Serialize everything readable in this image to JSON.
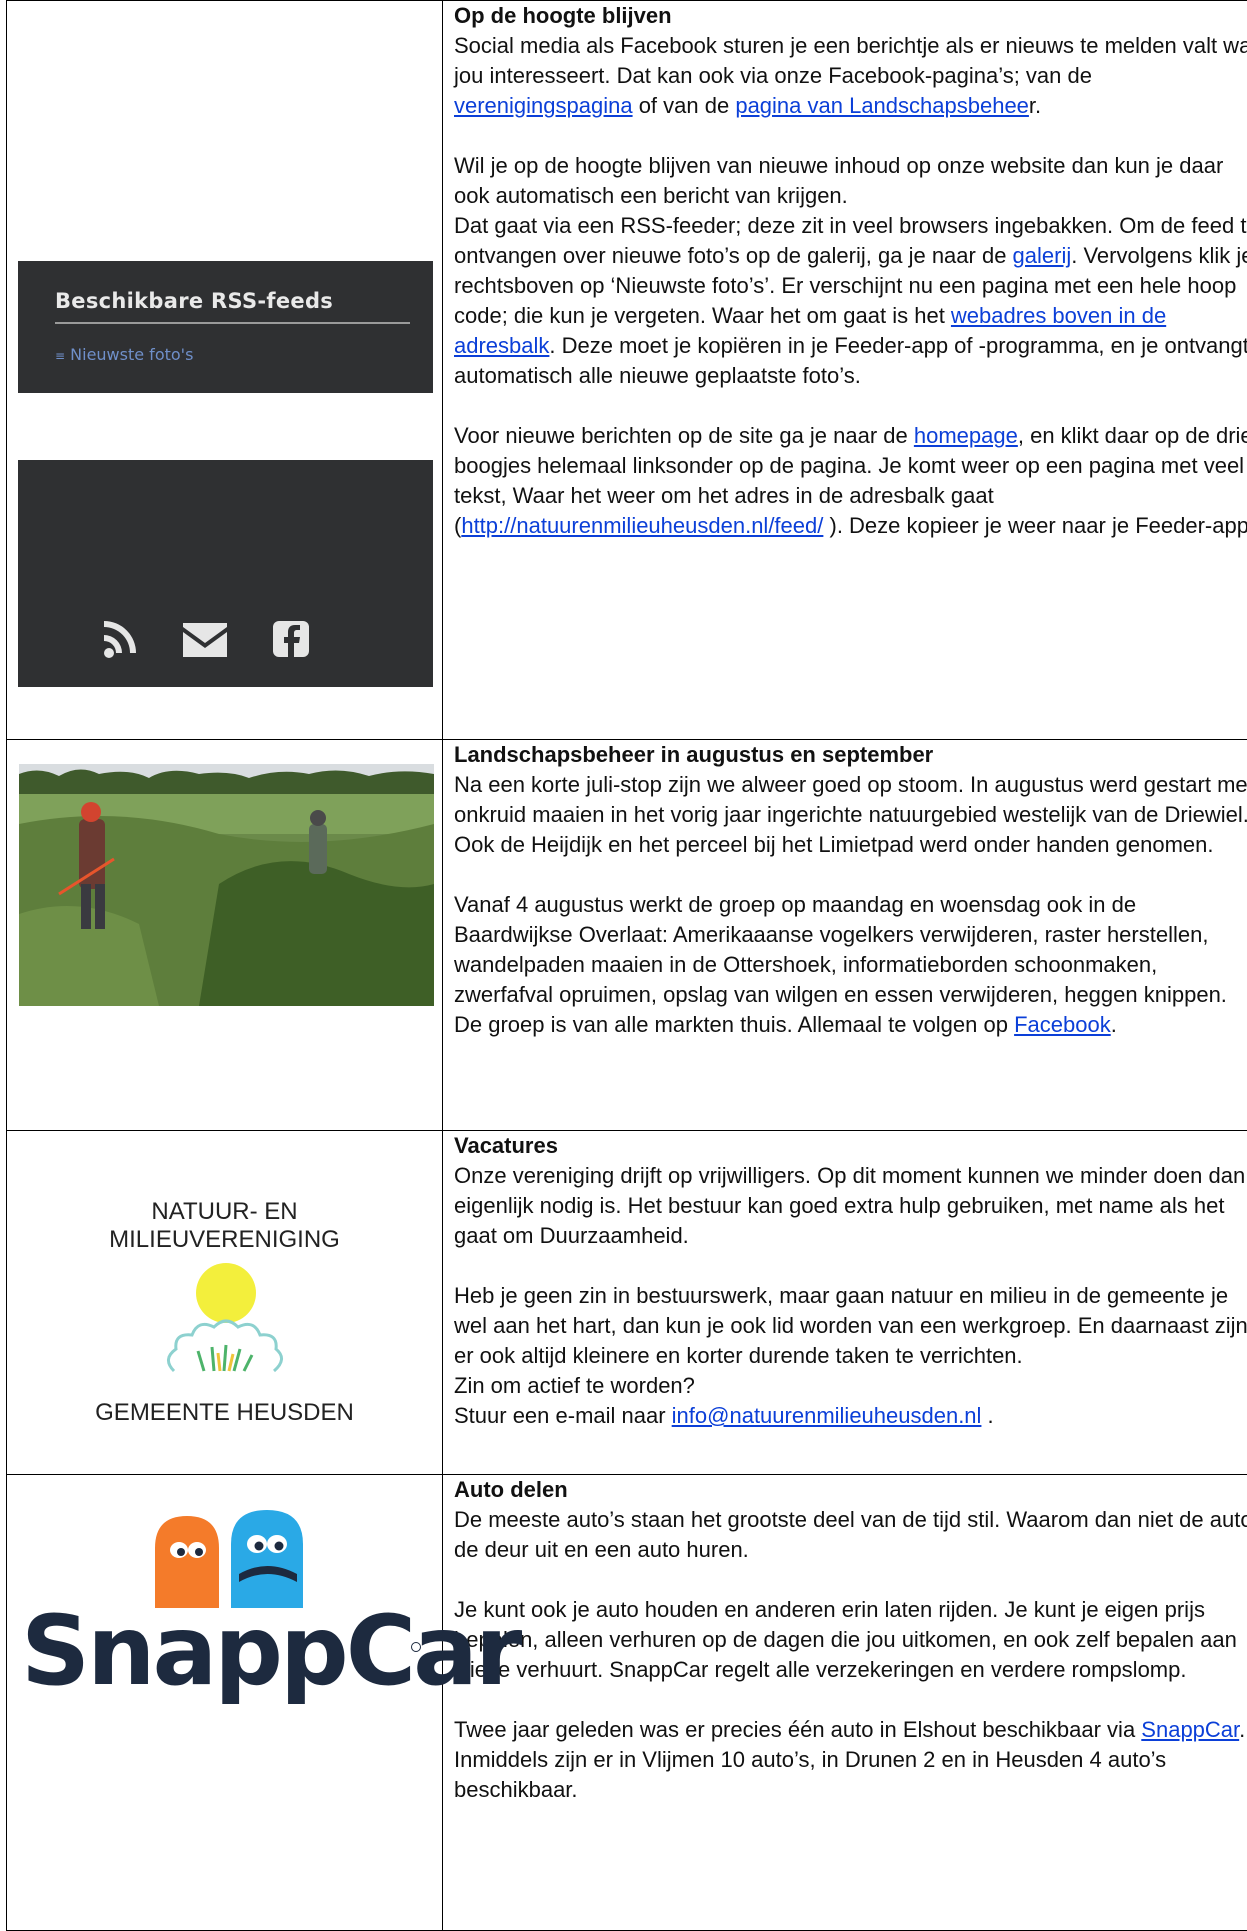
{
  "rss_screenshot": {
    "title": "Beschikbare RSS-feeds",
    "link": "Nieuwste foto's"
  },
  "articles": [
    {
      "title": "Op de hoogte blijven",
      "p1": [
        "Social media als Facebook sturen je een berichtje als er nieuws te melden valt wat jou interesseert. Dat kan ook via onze Facebook-pagina’s; van de ",
        "verenigingspagina",
        " of van de ",
        "pagina van Landschapsbehee",
        "r."
      ],
      "p2": "Wil je op de hoogte blijven van nieuwe inhoud op onze website dan kun je daar ook automatisch een bericht van krijgen.",
      "p3": [
        "Dat gaat via een RSS-feeder; deze zit in veel browsers ingebakken. Om de feed te ontvangen over nieuwe foto’s op de galerij, ga je naar de ",
        "galerij",
        ". Vervolgens klik je rechtsboven op ‘Nieuwste foto’s’. Er verschijnt nu een pagina met een hele hoop code; die kun je vergeten. Waar het om gaat is het ",
        "webadres boven in de adresbalk",
        ". Deze moet je kopiëren in je Feeder-app of -programma, en je ontvangt automatisch alle nieuwe geplaatste foto’s."
      ],
      "p4": [
        "Voor nieuwe berichten op de site ga je naar de ",
        "homepage",
        ", en klikt daar op de drie boogjes helemaal linksonder op de pagina. Je komt weer op een pagina met veel tekst, Waar het weer om het adres in de adresbalk gaat (",
        "http://natuurenmilieuheusden.nl/feed/",
        " ). Deze kopieer je weer naar je Feeder-app."
      ]
    },
    {
      "title": "Landschapsbeheer in augustus en september",
      "p1": "Na een korte juli-stop zijn we alweer goed op stoom. In augustus werd gestart met onkruid maaien in het vorig jaar ingerichte natuurgebied westelijk van de Driewiel. Ook de Heijdijk en het perceel bij het Limietpad werd onder handen genomen.",
      "p2": [
        "Vanaf 4 augustus werkt de groep op maandag en woensdag ook in de Baardwijkse Overlaat: Amerikaaanse vogelkers verwijderen, raster herstellen, wandelpaden maaien in de Ottershoek, informatieborden schoonmaken, zwerfafval opruimen, opslag van wilgen en essen verwijderen, heggen knippen. De groep is van alle markten thuis. Allemaal te volgen op ",
        "Facebook",
        "."
      ]
    },
    {
      "title": "Vacatures",
      "p1": "Onze vereniging drijft op vrijwilligers. Op dit moment kunnen we minder doen dan eigenlijk nodig is. Het bestuur kan goed extra hulp gebruiken, met name als het gaat om Duurzaamheid.",
      "p2": "Heb je geen zin in bestuurswerk, maar gaan natuur en milieu in de gemeente je wel aan het hart, dan kun je ook lid worden van een werkgroep. En daarnaast zijn er ook altijd kleinere en korter durende taken te verrichten.",
      "p3": "Zin om actief te worden?",
      "p4": [
        "Stuur een e-mail naar ",
        "info@natuurenmilieuheusden.nl",
        " ."
      ]
    },
    {
      "title": "Auto delen",
      "p1": "De meeste auto’s staan het grootste deel van de tijd stil. Waarom dan niet de auto de deur uit en een auto huren.",
      "p2": "Je kunt ook je auto houden en anderen erin laten rijden. Je kunt je eigen prijs bepalen, alleen verhuren op de dagen die jou uitkomen, en ook zelf bepalen aan wie je verhuurt. SnappCar regelt alle verzekeringen en verdere rompslomp.",
      "p3": [
        "Twee jaar geleden was er precies één auto in Elshout beschikbaar via ",
        "SnappCar",
        ". Inmiddels zijn er in Vlijmen 10 auto’s, in Drunen 2 en in Heusden 4 auto’s beschikbaar."
      ]
    }
  ],
  "logo": {
    "line1": "NATUUR- EN",
    "line2": "MILIEUVERENIGING",
    "bottom": "GEMEENTE HEUSDEN"
  },
  "snappcar_logo": "SnappCar",
  "colors": {
    "link": "#0b3fd8",
    "panel": "#2f3032",
    "snapp_orange": "#f47b2a",
    "snapp_blue": "#2aa9e6"
  }
}
